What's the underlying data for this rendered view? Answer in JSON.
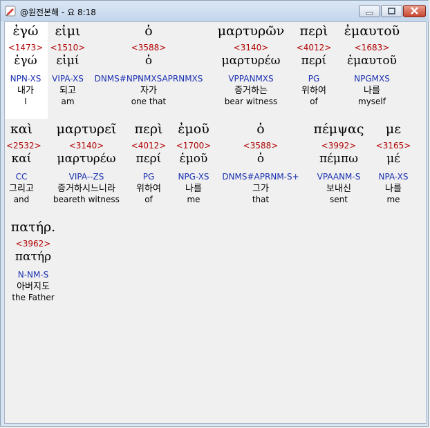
{
  "window": {
    "title": "@원전본해 - 요 8:18"
  },
  "icons": [
    "app-icon",
    "minimize-icon",
    "maximize-icon",
    "close-icon"
  ],
  "colors": {
    "strongs": "#b00000",
    "parsing": "#1a2fb0",
    "selection": "#ffffff"
  },
  "words": [
    {
      "greek": "ἐγώ",
      "strongs": "<1473>",
      "lexical": "ἐγώ",
      "parsing": "NPN-XS",
      "korean": "내가",
      "english": "I"
    },
    {
      "greek": "εἰμι",
      "strongs": "<1510>",
      "lexical": "εἰμί",
      "parsing": "VIPA-XS",
      "korean": "되고",
      "english": "am"
    },
    {
      "greek": "ὁ",
      "strongs": "<3588>",
      "lexical": "ὁ",
      "parsing": "DNMS#NPNMXSAPRNMXS",
      "korean": "자가",
      "english": "one that"
    },
    {
      "greek": "μαρτυρῶν",
      "strongs": "<3140>",
      "lexical": "μαρτυρέω",
      "parsing": "VPPANMXS",
      "korean": "증거하는",
      "english": "bear witness"
    },
    {
      "greek": "περὶ",
      "strongs": "<4012>",
      "lexical": "περί",
      "parsing": "PG",
      "korean": "위하여",
      "english": "of"
    },
    {
      "greek": "ἐμαυτοῦ",
      "strongs": "<1683>",
      "lexical": "ἐμαυτοῦ",
      "parsing": "NPGMXS",
      "korean": "나를",
      "english": "myself"
    },
    {
      "greek": "καὶ",
      "strongs": "<2532>",
      "lexical": "καί",
      "parsing": "CC",
      "korean": "그리고",
      "english": "and"
    },
    {
      "greek": "μαρτυρεῖ",
      "strongs": "<3140>",
      "lexical": "μαρτυρέω",
      "parsing": "VIPA--ZS",
      "korean": "증거하시느니라",
      "english": "beareth witness"
    },
    {
      "greek": "περὶ",
      "strongs": "<4012>",
      "lexical": "περί",
      "parsing": "PG",
      "korean": "위하여",
      "english": "of"
    },
    {
      "greek": "ἐμοῦ",
      "strongs": "<1700>",
      "lexical": "ἐμοῦ",
      "parsing": "NPG-XS",
      "korean": "나를",
      "english": "me"
    },
    {
      "greek": "ὁ",
      "strongs": "<3588>",
      "lexical": "ὁ",
      "parsing": "DNMS#APRNM-S+",
      "korean": "그가",
      "english": "that"
    },
    {
      "greek": "πέμψας",
      "strongs": "<3992>",
      "lexical": "πέμπω",
      "parsing": "VPAANM-S",
      "korean": "보내신",
      "english": "sent"
    },
    {
      "greek": "με",
      "strongs": "<3165>",
      "lexical": "μέ",
      "parsing": "NPA-XS",
      "korean": "나를",
      "english": "me"
    },
    {
      "greek": "πατήρ.",
      "strongs": "<3962>",
      "lexical": "πατήρ",
      "parsing": "N-NM-S",
      "korean": "아버지도",
      "english": "the Father"
    }
  ]
}
